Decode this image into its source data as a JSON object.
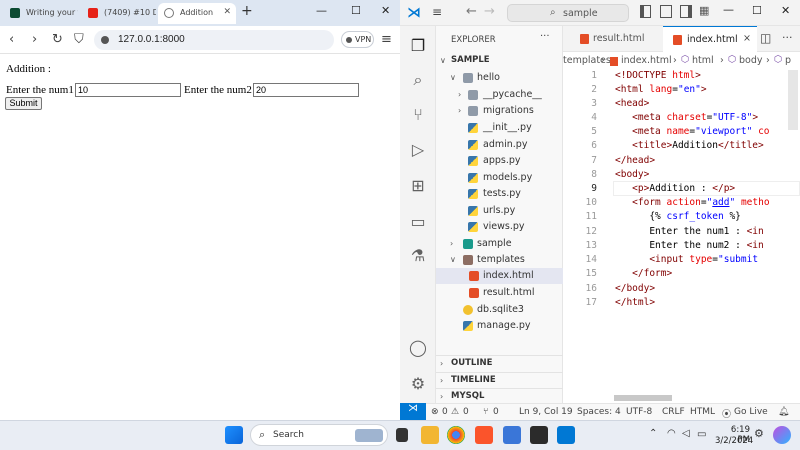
{
  "browser": {
    "tabs": [
      {
        "label": "Writing your f",
        "icon": "django-icon"
      },
      {
        "label": "(7409) #10 Dj",
        "icon": "youtube-icon"
      },
      {
        "label": "Addition",
        "icon": "globe-icon"
      }
    ],
    "new_tab": "+",
    "url": "127.0.0.1:8000",
    "vpn_label": "VPN",
    "page": {
      "heading": "Addition :",
      "label1": "Enter the num1 :",
      "value1": "10",
      "label2": "Enter the num2 :",
      "value2": "20",
      "submit": "Submit"
    }
  },
  "vscode": {
    "search": "sample",
    "explorer_title": "EXPLORER",
    "explorer_more": "···",
    "project": "SAMPLE",
    "tree": [
      {
        "label": "hello",
        "type": "folder",
        "open": true
      },
      {
        "label": "__pycache__",
        "type": "folder",
        "open": false
      },
      {
        "label": "migrations",
        "type": "folder",
        "open": false
      },
      {
        "label": "__init__.py",
        "type": "py"
      },
      {
        "label": "admin.py",
        "type": "py"
      },
      {
        "label": "apps.py",
        "type": "py"
      },
      {
        "label": "models.py",
        "type": "py"
      },
      {
        "label": "tests.py",
        "type": "py"
      },
      {
        "label": "urls.py",
        "type": "py"
      },
      {
        "label": "views.py",
        "type": "py"
      },
      {
        "label": "sample",
        "type": "folder",
        "open": false
      },
      {
        "label": "templates",
        "type": "folder",
        "open": true
      },
      {
        "label": "index.html",
        "type": "html",
        "selected": true
      },
      {
        "label": "result.html",
        "type": "html"
      },
      {
        "label": "db.sqlite3",
        "type": "db"
      },
      {
        "label": "manage.py",
        "type": "py"
      }
    ],
    "sections": [
      "OUTLINE",
      "TIMELINE",
      "MYSQL"
    ],
    "editor_tabs": [
      {
        "label": "result.html",
        "active": false
      },
      {
        "label": "index.html",
        "active": true,
        "close": "×"
      }
    ],
    "breadcrumb": [
      "templates",
      "index.html",
      "html",
      "body",
      "p"
    ],
    "line_numbers": [
      "1",
      "2",
      "3",
      "4",
      "5",
      "6",
      "7",
      "8",
      "9",
      "10",
      "11",
      "12",
      "13",
      "14",
      "15",
      "16",
      "17"
    ],
    "status": {
      "errors": "0",
      "warnings": "0",
      "ports": "0",
      "position": "Ln 9, Col 19",
      "spaces": "Spaces: 4",
      "encoding": "UTF-8",
      "eol": "CRLF",
      "language": "HTML",
      "golive": "Go Live"
    }
  },
  "taskbar": {
    "search_placeholder": "Search",
    "time": "6:19 PM",
    "date": "3/2/2024"
  }
}
